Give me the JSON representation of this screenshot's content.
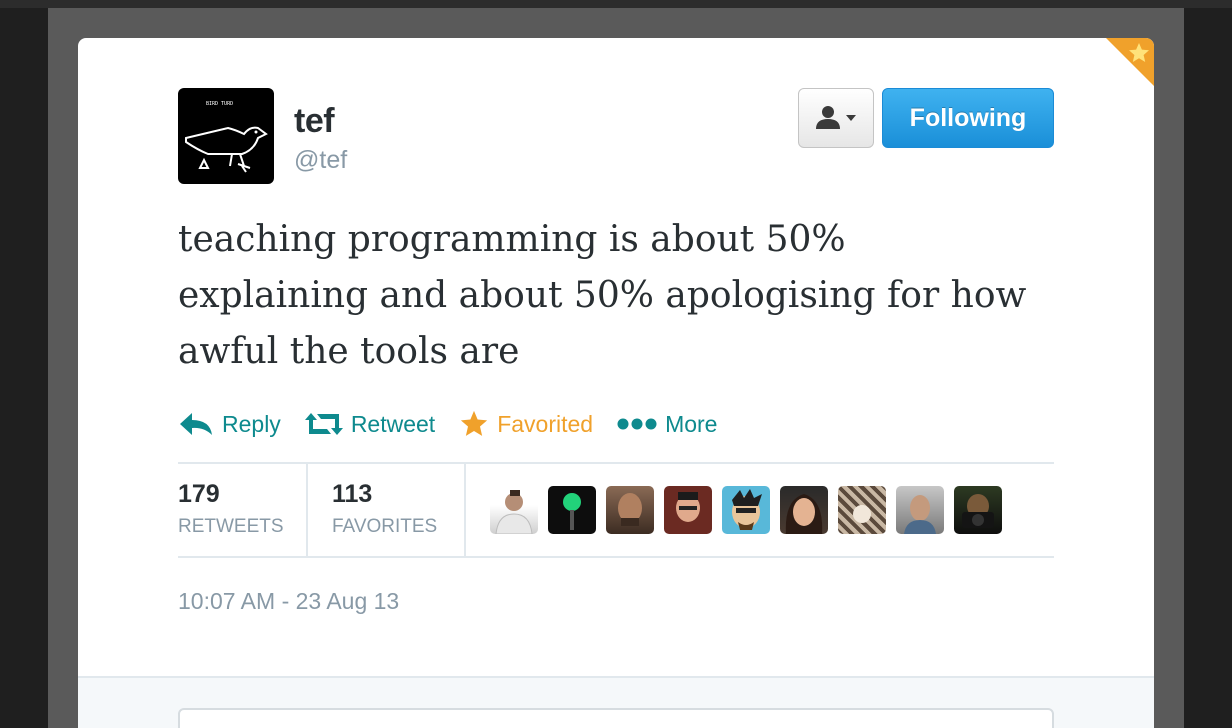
{
  "user": {
    "display_name": "tef",
    "screen_name": "@tef",
    "avatar_icon": "bird-drawing-icon"
  },
  "buttons": {
    "user_actions_icon": "person-dropdown-icon",
    "follow_label": "Following"
  },
  "tweet": {
    "text": "teaching programming is about 50% explaining and about 50% apologising for how awful the tools are"
  },
  "actions": {
    "reply_label": "Reply",
    "retweet_label": "Retweet",
    "favorite_label": "Favorited",
    "more_label": "More"
  },
  "stats": {
    "retweets_count": "179",
    "retweets_label": "RETWEETS",
    "favorites_count": "113",
    "favorites_label": "FAVORITES",
    "favoriter_avatars": [
      "avatar-man-white-shirt",
      "avatar-green-light",
      "avatar-man-beard",
      "avatar-man-glasses",
      "avatar-cartoon",
      "avatar-woman",
      "avatar-pattern",
      "avatar-man-office",
      "avatar-camera"
    ]
  },
  "timestamp": "10:07 AM - 23 Aug 13",
  "colors": {
    "accent_teal": "#0e8a8e",
    "favorite_orange": "#f0a12b",
    "follow_blue": "#1a8fd8",
    "text_dark": "#292f33",
    "text_muted": "#8899a6"
  }
}
